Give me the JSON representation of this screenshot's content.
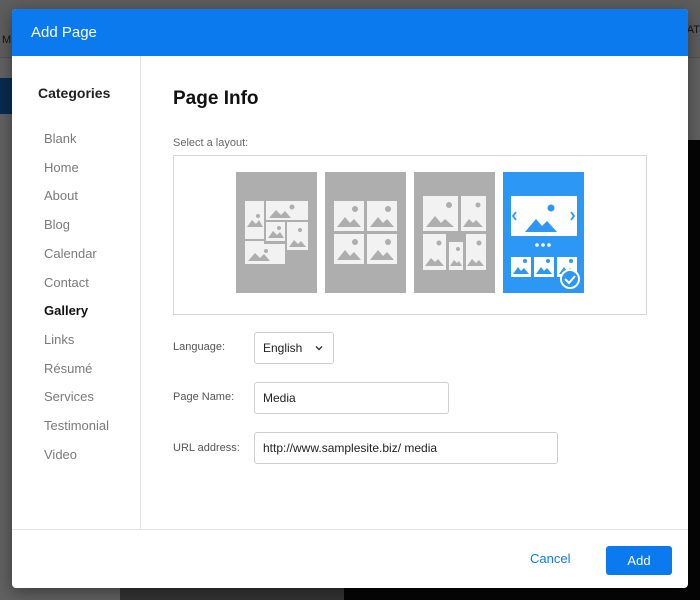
{
  "background": {
    "left_text": "M",
    "right_text": "AT"
  },
  "dialog": {
    "title": "Add Page"
  },
  "sidebar": {
    "title": "Categories",
    "items": [
      {
        "label": "Blank",
        "active": false
      },
      {
        "label": "Home",
        "active": false
      },
      {
        "label": "About",
        "active": false
      },
      {
        "label": "Blog",
        "active": false
      },
      {
        "label": "Calendar",
        "active": false
      },
      {
        "label": "Contact",
        "active": false
      },
      {
        "label": "Gallery",
        "active": true
      },
      {
        "label": "Links",
        "active": false
      },
      {
        "label": "Résumé",
        "active": false
      },
      {
        "label": "Services",
        "active": false
      },
      {
        "label": "Testimonial",
        "active": false
      },
      {
        "label": "Video",
        "active": false
      }
    ]
  },
  "main": {
    "title": "Page Info",
    "layout_label": "Select a layout:",
    "layouts": [
      {
        "icon": "masonry-gallery-layout",
        "selected": false
      },
      {
        "icon": "grid-gallery-layout",
        "selected": false
      },
      {
        "icon": "mixed-gallery-layout",
        "selected": false
      },
      {
        "icon": "slideshow-gallery-layout",
        "selected": true
      }
    ],
    "language": {
      "label": "Language:",
      "value": "English"
    },
    "page_name": {
      "label": "Page Name:",
      "value": "Media"
    },
    "url": {
      "label": "URL address:",
      "value": "http://www.samplesite.biz/ media"
    }
  },
  "footer": {
    "cancel_label": "Cancel",
    "add_label": "Add"
  },
  "colors": {
    "accent": "#0b7aef",
    "selected_layout": "#2d97f5",
    "layout_gray": "#aeaeae"
  }
}
